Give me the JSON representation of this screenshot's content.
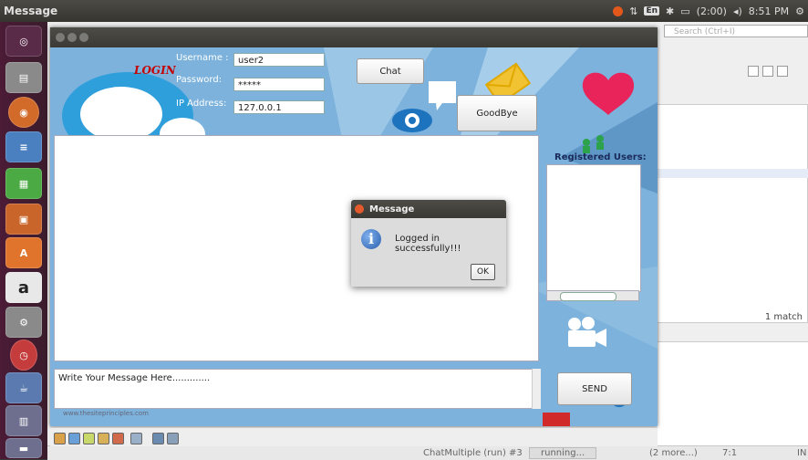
{
  "topbar": {
    "title": "Message",
    "lang": "En",
    "battery": "(2:00)",
    "time": "8:51 PM"
  },
  "ide": {
    "search_placeholder": "Search (Ctrl+I)",
    "match_count": "1 match",
    "status_task": "ChatMultiple (run) #3",
    "status_state": "running...",
    "status_more": "(2 more...)",
    "status_pos": "7:1",
    "status_mode": "IN"
  },
  "chat": {
    "login_heading": "LOGIN",
    "username_label": "Username :",
    "username_value": "user2",
    "password_label": "Password:",
    "password_value": "*****",
    "ip_label": "IP Address:",
    "ip_value": "127.0.0.1",
    "chat_button": "Chat",
    "goodbye_button": "GoodBye",
    "registered_users_label": "Registered Users:",
    "message_placeholder": "Write Your Message Here.............",
    "send_button": "SEND",
    "watermark": "www.thesiteprinciples.com"
  },
  "dialog": {
    "title": "Message",
    "text": "Logged in successfully!!!",
    "ok_label": "OK"
  },
  "colors": {
    "launcher_bg": "#4c1b36",
    "chat_bg": "#6fa5cf",
    "dialog_bg": "#dcdcdc"
  }
}
